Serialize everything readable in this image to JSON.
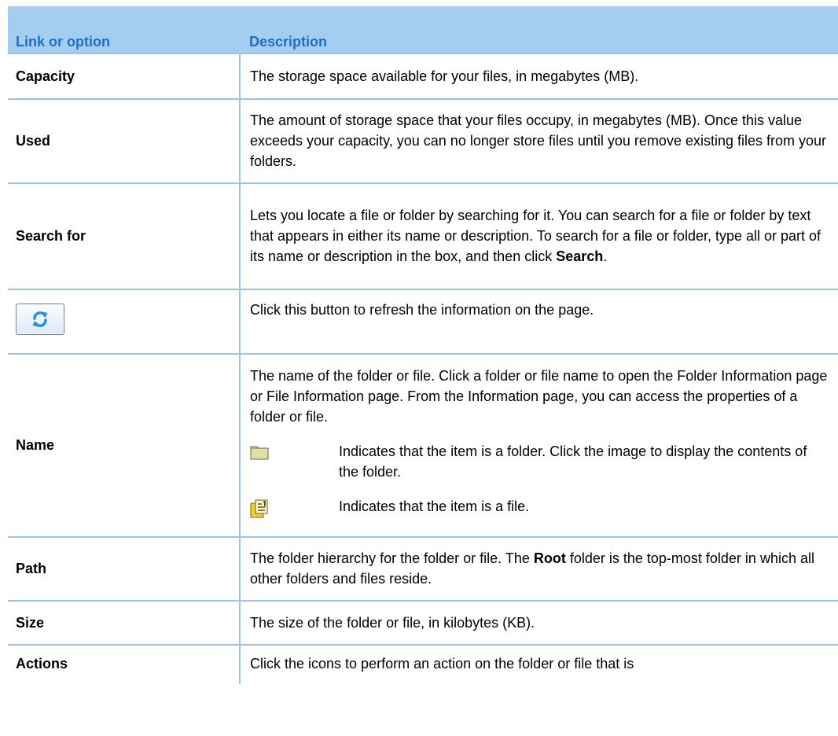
{
  "header": {
    "term_label": "Link or option",
    "description_label": "Description"
  },
  "rows": {
    "capacity": {
      "term": "Capacity",
      "description": "The storage space available for your files, in megabytes (MB)."
    },
    "used": {
      "term": "Used",
      "description": "The amount of storage space that your files occupy, in megabytes (MB). Once this value exceeds your capacity, you can no longer store files until you remove existing files from your folders."
    },
    "search_for": {
      "term": "Search for",
      "description_before": "Lets you locate a file or folder by searching for it. You can search for a file or folder by text that appears in either its name or description. To search for a file or folder, type all or part of its name or description in the box, and then click ",
      "description_bold": "Search",
      "description_after": "."
    },
    "refresh": {
      "icon": "refresh-icon",
      "description": "Click this button to refresh the information on the page."
    },
    "name": {
      "term": "Name",
      "description": "The name of the folder or file. Click a folder or file name to open the Folder Information page or File Information page. From the Information page, you can access the properties of a folder or file.",
      "folder_icon": "folder-icon",
      "folder_text": "Indicates that the item is a folder. Click the image to display the contents of the folder.",
      "file_icon": "file-icon",
      "file_text": "Indicates that the item is a file."
    },
    "path": {
      "term": "Path",
      "description_before": "The folder hierarchy for the folder or file. The ",
      "description_bold": "Root",
      "description_after": " folder is the top-most folder in which all other folders and files reside."
    },
    "size": {
      "term": "Size",
      "description": "The size of the folder or file, in kilobytes (KB)."
    },
    "actions": {
      "term": "Actions",
      "description": "Click the icons to perform an action on the folder or file that is"
    }
  },
  "colors": {
    "header_bg": "#a5cdf0",
    "header_text": "#1f6fc6",
    "rule": "#9cc3e5"
  }
}
